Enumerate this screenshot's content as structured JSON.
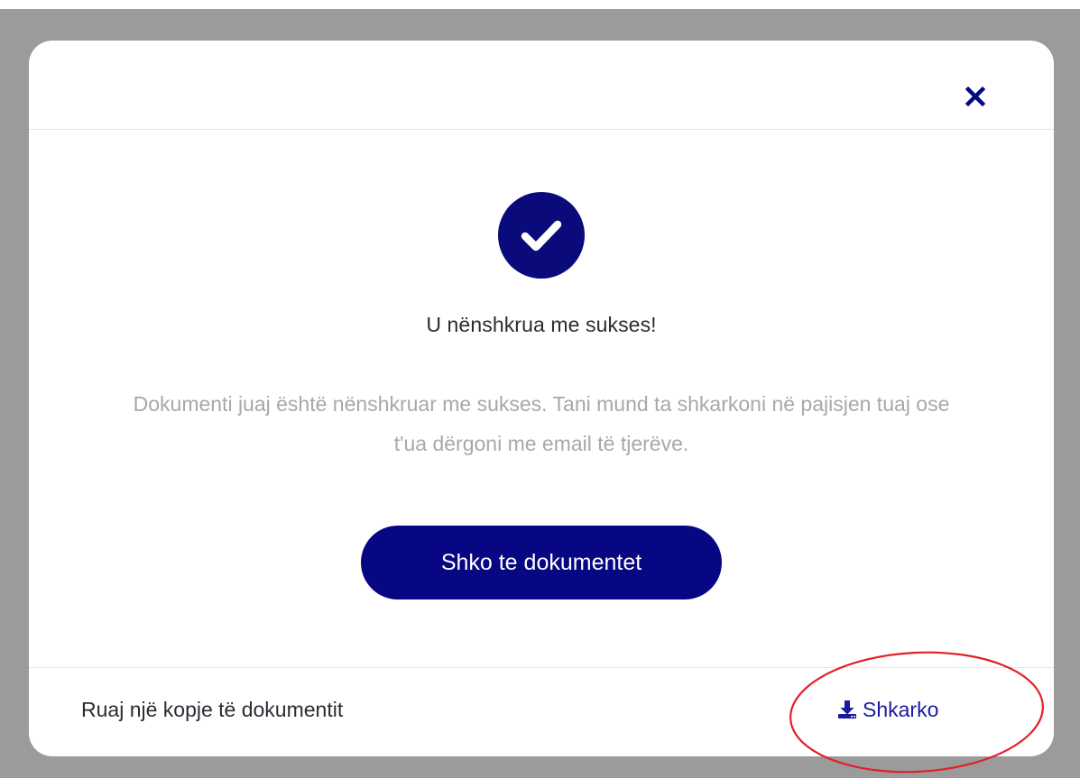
{
  "modal": {
    "title": "U nënshkrua me sukses!",
    "message": "Dokumenti juaj është nënshkruar me sukses. Tani mund ta shkarkoni në pajisjen tuaj ose t'ua dërgoni me email të tjerëve.",
    "primary_button_label": "Shko te dokumentet",
    "close_icon": "close-icon",
    "status_icon": "check-circle-icon"
  },
  "footer": {
    "label": "Ruaj një kopje të dokumentit",
    "download_label": "Shkarko",
    "download_icon": "download-icon"
  },
  "colors": {
    "brand": "#070783",
    "link": "#1a1aa0",
    "annotation": "#e0202a",
    "overlay": "#9b9b9b"
  }
}
